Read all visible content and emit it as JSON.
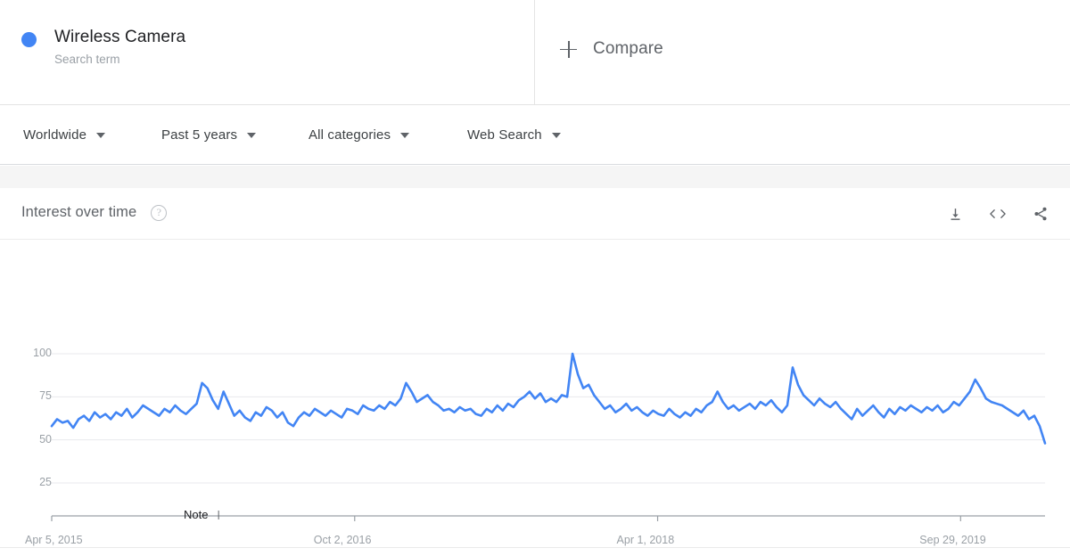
{
  "term": {
    "title": "Wireless Camera",
    "subtitle": "Search term",
    "dot_color": "#4285f4"
  },
  "compare": {
    "label": "Compare",
    "icon": "plus-icon"
  },
  "filters": [
    {
      "label": "Worldwide",
      "icon": "chevron-down-icon"
    },
    {
      "label": "Past 5 years",
      "icon": "chevron-down-icon"
    },
    {
      "label": "All categories",
      "icon": "chevron-down-icon"
    },
    {
      "label": "Web Search",
      "icon": "chevron-down-icon"
    }
  ],
  "chart_panel": {
    "title": "Interest over time",
    "help_icon": "question-mark-icon",
    "help_glyph": "?",
    "actions": [
      {
        "name": "download-icon",
        "tooltip": "Download"
      },
      {
        "name": "embed-code-icon",
        "tooltip": "Embed"
      },
      {
        "name": "share-icon",
        "tooltip": "Share"
      }
    ]
  },
  "chart_data": {
    "type": "line",
    "title": "Interest over time",
    "xlabel": "",
    "ylabel": "",
    "ylim": [
      0,
      105
    ],
    "yticks": [
      100,
      75,
      50,
      25
    ],
    "grid": true,
    "legend": false,
    "line_color": "#4285f4",
    "line_width": 2.6,
    "xticks": [
      "Apr 5, 2015",
      "Oct 2, 2016",
      "Apr 1, 2018",
      "Sep 29, 2019"
    ],
    "xtick_positions": [
      0.0,
      0.305,
      0.61,
      0.915
    ],
    "annotations": [
      {
        "text": "Note",
        "x_fraction": 0.168,
        "name": "note-annotation"
      }
    ],
    "series": [
      {
        "name": "Wireless Camera",
        "values": [
          58,
          62,
          60,
          61,
          57,
          62,
          64,
          61,
          66,
          63,
          65,
          62,
          66,
          64,
          68,
          63,
          66,
          70,
          68,
          66,
          64,
          68,
          66,
          70,
          67,
          65,
          68,
          71,
          83,
          80,
          73,
          68,
          78,
          71,
          64,
          67,
          63,
          61,
          66,
          64,
          69,
          67,
          63,
          66,
          60,
          58,
          63,
          66,
          64,
          68,
          66,
          64,
          67,
          65,
          63,
          68,
          67,
          65,
          70,
          68,
          67,
          70,
          68,
          72,
          70,
          74,
          83,
          78,
          72,
          74,
          76,
          72,
          70,
          67,
          68,
          66,
          69,
          67,
          68,
          65,
          64,
          68,
          66,
          70,
          67,
          71,
          69,
          73,
          75,
          78,
          74,
          77,
          72,
          74,
          72,
          76,
          75,
          100,
          88,
          80,
          82,
          76,
          72,
          68,
          70,
          66,
          68,
          71,
          67,
          69,
          66,
          64,
          67,
          65,
          64,
          68,
          65,
          63,
          66,
          64,
          68,
          66,
          70,
          72,
          78,
          72,
          68,
          70,
          67,
          69,
          71,
          68,
          72,
          70,
          73,
          69,
          66,
          70,
          92,
          82,
          76,
          73,
          70,
          74,
          71,
          69,
          72,
          68,
          65,
          62,
          68,
          64,
          67,
          70,
          66,
          63,
          68,
          65,
          69,
          67,
          70,
          68,
          66,
          69,
          67,
          70,
          66,
          68,
          72,
          70,
          74,
          78,
          85,
          80,
          74,
          72,
          71,
          70,
          68,
          66,
          64,
          67,
          62,
          64,
          58,
          48
        ]
      }
    ]
  }
}
